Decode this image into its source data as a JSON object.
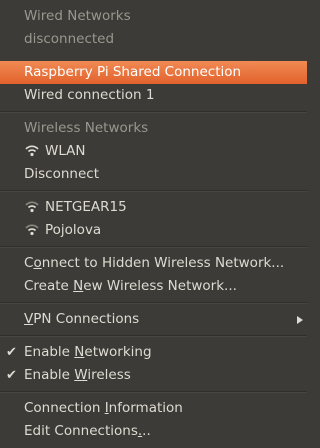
{
  "menu": {
    "wired_header": "Wired Networks",
    "wired_status": "disconnected",
    "wired_items": [
      "Raspberry Pi Shared Connection",
      "Wired connection 1"
    ],
    "wireless_header": "Wireless Networks",
    "active_network": "WLAN",
    "disconnect_label": "Disconnect",
    "networks": [
      "NETGEAR15",
      "Pojolova"
    ],
    "hidden_pre": "C",
    "hidden_key": "o",
    "hidden_post": "nnect to Hidden Wireless Network...",
    "create_pre": "Create ",
    "create_key": "N",
    "create_post": "ew Wireless Network...",
    "vpn_key": "V",
    "vpn_post": "PN Connections",
    "enable_net_pre": "Enable ",
    "enable_net_key": "N",
    "enable_net_post": "etworking",
    "enable_net_checked": true,
    "enable_wifi_pre": "Enable ",
    "enable_wifi_key": "W",
    "enable_wifi_post": "ireless",
    "enable_wifi_checked": true,
    "conn_info_pre": "Connection ",
    "conn_info_key": "I",
    "conn_info_post": "nformation",
    "edit_pre": "Edit Connections",
    "edit_key": ".",
    "edit_post": "..",
    "check_glyph": "✔",
    "icons": {
      "wifi": "wifi-signal-icon",
      "check": "check-icon",
      "submenu": "chevron-right-icon"
    },
    "colors": {
      "background": "#3c3b37",
      "highlight": "#e8703a",
      "text": "#dfdbd2",
      "disabled_text": "#9a978e"
    }
  }
}
